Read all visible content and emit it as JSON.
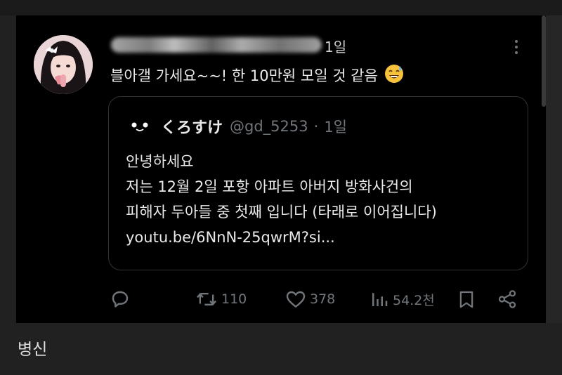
{
  "tweet": {
    "author_time": "1일",
    "text": "블아갤 가세요~~! 한 10만원 모일 것 같음",
    "emoji": "sweat-smile-emoji"
  },
  "quoted": {
    "name": "くろすけ",
    "handle": "@gd_5253",
    "separator": "·",
    "time": "1일",
    "lines": [
      "안녕하세요",
      "저는 12월 2일 포항 아파트 아버지 방화사건의",
      "피해자 두아들 중 첫째 입니다 (타래로 이어집니다)",
      "youtu.be/6NnN-25qwrM?si..."
    ]
  },
  "actions": {
    "retweets": "110",
    "likes": "378",
    "views": "54.2천"
  },
  "caption": "병신",
  "colors": {
    "background": "#000000",
    "text": "#e7e9ea",
    "muted": "#71767b",
    "border": "#2f3336",
    "page": "#212121"
  }
}
